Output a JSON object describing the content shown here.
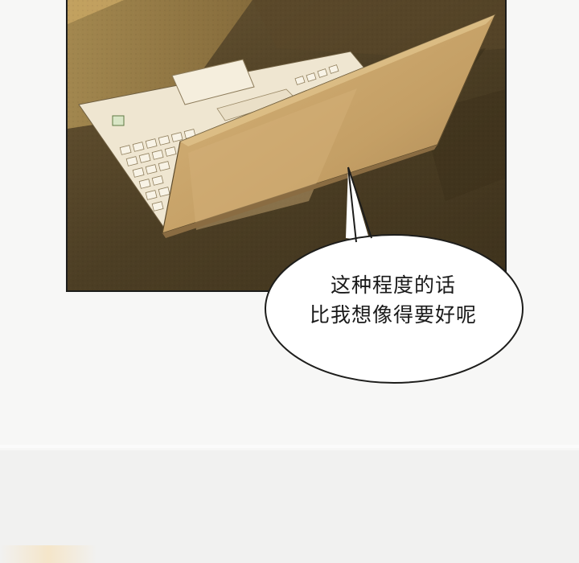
{
  "speech_bubble": {
    "lines": [
      "这种程度的话",
      "比我想像得要好呢"
    ]
  },
  "colors": {
    "desk_dark": "#4a3c22",
    "desk_light": "#b79a5a",
    "laptop_body": "#efe6d1",
    "laptop_lid": "#c8a46a",
    "bubble_fill": "#ffffff",
    "outline": "#1d1d1b"
  }
}
